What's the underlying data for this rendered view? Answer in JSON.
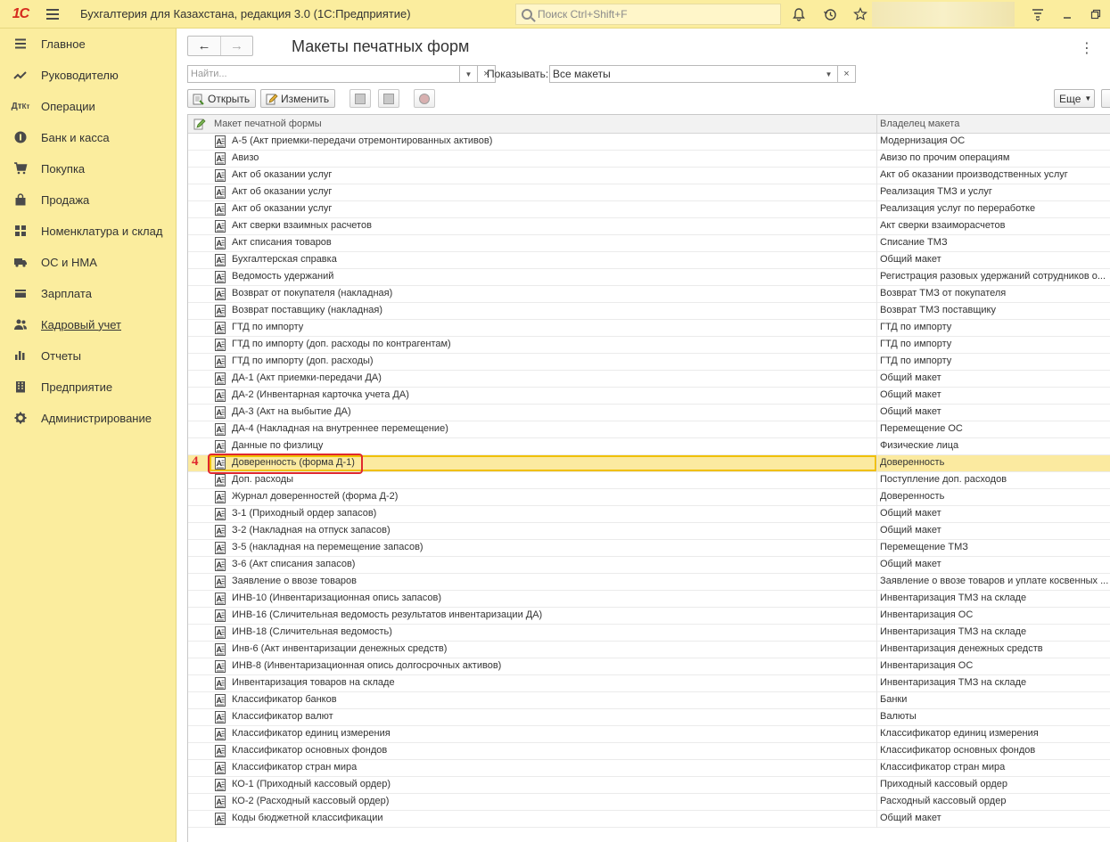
{
  "app": {
    "logo": "1С",
    "title": "Бухгалтерия для Казахстана, редакция 3.0  (1С:Предприятие)",
    "search_placeholder": "Поиск Ctrl+Shift+F"
  },
  "sidebar": {
    "items": [
      {
        "label": "Главное",
        "icon": "menu-lines-icon"
      },
      {
        "label": "Руководителю",
        "icon": "trend-icon"
      },
      {
        "label": "Операции",
        "icon": "dt-kt-icon"
      },
      {
        "label": "Банк и касса",
        "icon": "coin-icon"
      },
      {
        "label": "Покупка",
        "icon": "cart-icon"
      },
      {
        "label": "Продажа",
        "icon": "bag-icon"
      },
      {
        "label": "Номенклатура и склад",
        "icon": "grid-icon"
      },
      {
        "label": "ОС и НМА",
        "icon": "truck-icon"
      },
      {
        "label": "Зарплата",
        "icon": "wallet-icon"
      },
      {
        "label": "Кадровый учет",
        "icon": "people-icon"
      },
      {
        "label": "Отчеты",
        "icon": "bars-icon"
      },
      {
        "label": "Предприятие",
        "icon": "building-icon"
      },
      {
        "label": "Администрирование",
        "icon": "gear-icon"
      }
    ]
  },
  "page": {
    "title": "Макеты печатных форм",
    "find_placeholder": "Найти...",
    "show_label": "Показывать:",
    "show_value": "Все макеты",
    "open_label": "Открыть",
    "edit_label": "Изменить",
    "more_label": "Еще"
  },
  "table": {
    "col1": "Макет печатной формы",
    "col2": "Владелец макета",
    "selected_index": 19,
    "step_number": "4",
    "rows": [
      [
        "А-5 (Акт приемки-передачи отремонтированных активов)",
        "Модернизация ОС"
      ],
      [
        "Авизо",
        "Авизо по прочим операциям"
      ],
      [
        "Акт об оказании услуг",
        "Акт об оказании производственных услуг"
      ],
      [
        "Акт об оказании услуг",
        "Реализация ТМЗ и услуг"
      ],
      [
        "Акт об оказании услуг",
        "Реализация услуг по переработке"
      ],
      [
        "Акт сверки взаимных расчетов",
        "Акт сверки взаиморасчетов"
      ],
      [
        "Акт списания товаров",
        "Списание ТМЗ"
      ],
      [
        "Бухгалтерская справка",
        "Общий макет"
      ],
      [
        "Ведомость удержаний",
        "Регистрация разовых удержаний сотрудников о..."
      ],
      [
        "Возврат от покупателя (накладная)",
        "Возврат ТМЗ от покупателя"
      ],
      [
        "Возврат поставщику (накладная)",
        "Возврат ТМЗ поставщику"
      ],
      [
        "ГТД по импорту",
        "ГТД по импорту"
      ],
      [
        "ГТД по импорту (доп. расходы по контрагентам)",
        "ГТД по импорту"
      ],
      [
        "ГТД по импорту (доп. расходы)",
        "ГТД по импорту"
      ],
      [
        "ДА-1 (Акт приемки-передачи ДА)",
        "Общий макет"
      ],
      [
        "ДА-2 (Инвентарная карточка учета ДА)",
        "Общий макет"
      ],
      [
        "ДА-3 (Акт на выбытие ДА)",
        "Общий макет"
      ],
      [
        "ДА-4 (Накладная на внутреннее перемещение)",
        "Перемещение ОС"
      ],
      [
        "Данные по физлицу",
        "Физические лица"
      ],
      [
        "Доверенность (форма Д-1)",
        "Доверенность"
      ],
      [
        "Доп. расходы",
        "Поступление доп. расходов"
      ],
      [
        "Журнал доверенностей (форма Д-2)",
        "Доверенность"
      ],
      [
        "З-1 (Приходный ордер запасов)",
        "Общий макет"
      ],
      [
        "З-2 (Накладная на отпуск запасов)",
        "Общий макет"
      ],
      [
        "З-5 (накладная на перемещение запасов)",
        "Перемещение ТМЗ"
      ],
      [
        "З-6 (Акт списания запасов)",
        "Общий макет"
      ],
      [
        "Заявление о ввозе товаров",
        "Заявление о ввозе товаров и уплате косвенных ..."
      ],
      [
        "ИНВ-10 (Инвентаризационная опись запасов)",
        "Инвентаризация ТМЗ на складе"
      ],
      [
        "ИНВ-16 (Сличительная ведомость результатов инвентаризации ДА)",
        "Инвентаризация ОС"
      ],
      [
        "ИНВ-18 (Сличительная ведомость)",
        "Инвентаризация ТМЗ на складе"
      ],
      [
        "Инв-6 (Акт инвентаризации денежных средств)",
        "Инвентаризация денежных средств"
      ],
      [
        "ИНВ-8 (Инвентаризационная опись долгосрочных активов)",
        "Инвентаризация ОС"
      ],
      [
        "Инвентаризация товаров на складе",
        "Инвентаризация ТМЗ на складе"
      ],
      [
        "Классификатор банков",
        "Банки"
      ],
      [
        "Классификатор валют",
        "Валюты"
      ],
      [
        "Классификатор единиц измерения",
        "Классификатор единиц измерения"
      ],
      [
        "Классификатор основных фондов",
        "Классификатор основных фондов"
      ],
      [
        "Классификатор стран мира",
        "Классификатор стран мира"
      ],
      [
        "КО-1 (Приходный кассовый ордер)",
        "Приходный кассовый ордер"
      ],
      [
        "КО-2 (Расходный кассовый ордер)",
        "Расходный кассовый ордер"
      ],
      [
        "Коды бюджетной классификации",
        "Общий макет"
      ]
    ]
  }
}
